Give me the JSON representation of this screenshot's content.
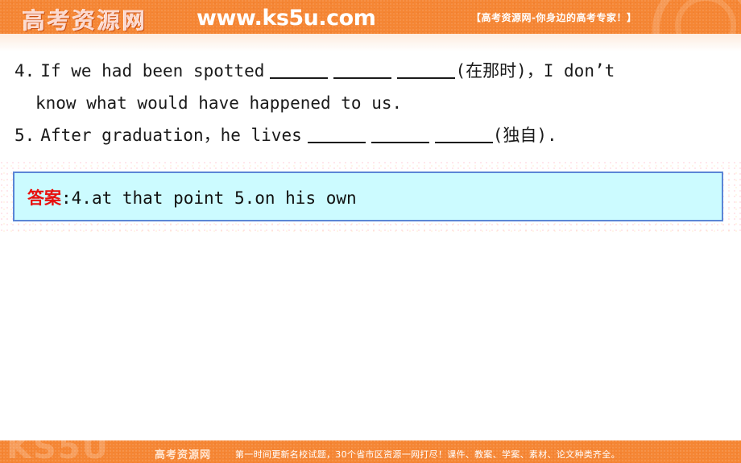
{
  "header": {
    "logo_cn": "高考资源网",
    "site_url": "www.ks5u.com",
    "tagline": "【高考资源网-你身边的高考专家！】",
    "bg_color": "#f58634"
  },
  "exercises": {
    "item4": {
      "number": "4.",
      "text_before": "If we had been spotted",
      "hint": "(在那时)，",
      "text_after": "I don’t",
      "blanks": 3,
      "continuation": "know what would have happened to us."
    },
    "item5": {
      "number": "5.",
      "text_before": "After graduation，he lives",
      "hint": "(独自).",
      "blanks": 3
    }
  },
  "answer": {
    "label": "答案",
    "separator": ":",
    "body": "4.at that point  5.on his own",
    "label_color": "#e8110f",
    "box_bg": "#ccfbff",
    "box_border": "#5b86d6"
  },
  "footer": {
    "watermark": "KS5U",
    "brand": "高考资源网",
    "note": "第一时间更新名校试题，30个省市区资源一网打尽！课件、教案、学案、素材、论文种类齐全。"
  }
}
